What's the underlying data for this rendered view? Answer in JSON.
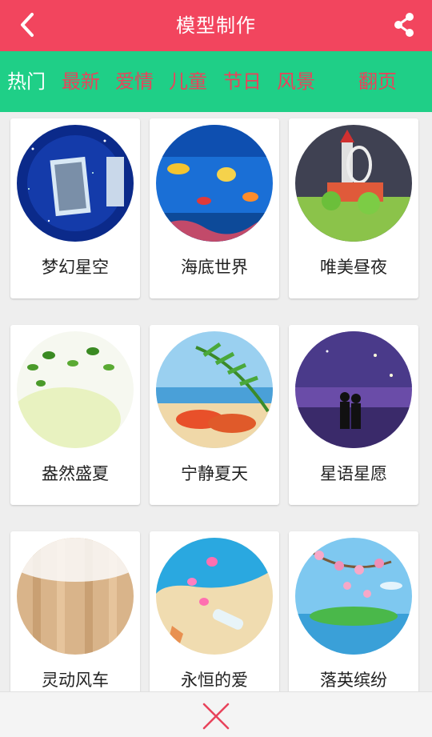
{
  "header": {
    "title": "模型制作",
    "back_icon": "chevron-left-icon",
    "share_icon": "share-icon"
  },
  "tabs": [
    {
      "label": "热门",
      "active": true
    },
    {
      "label": "最新",
      "active": false
    },
    {
      "label": "爱情",
      "active": false
    },
    {
      "label": "儿童",
      "active": false
    },
    {
      "label": "节日",
      "active": false
    },
    {
      "label": "风景",
      "active": false
    },
    {
      "label": "翻页",
      "active": false
    }
  ],
  "templates": [
    {
      "name": "梦幻星空"
    },
    {
      "name": "海底世界"
    },
    {
      "name": "唯美昼夜"
    },
    {
      "name": "盎然盛夏"
    },
    {
      "name": "宁静夏天"
    },
    {
      "name": "星语星愿"
    },
    {
      "name": "灵动风车"
    },
    {
      "name": "永恒的爱"
    },
    {
      "name": "落英缤纷"
    }
  ],
  "footer": {
    "close_icon": "close-icon"
  },
  "colors": {
    "header": "#f2455e",
    "tabs_bar": "#1fcf87",
    "tab_text": "#e8435b",
    "tab_active": "#ffffff",
    "close": "#e8435b"
  }
}
